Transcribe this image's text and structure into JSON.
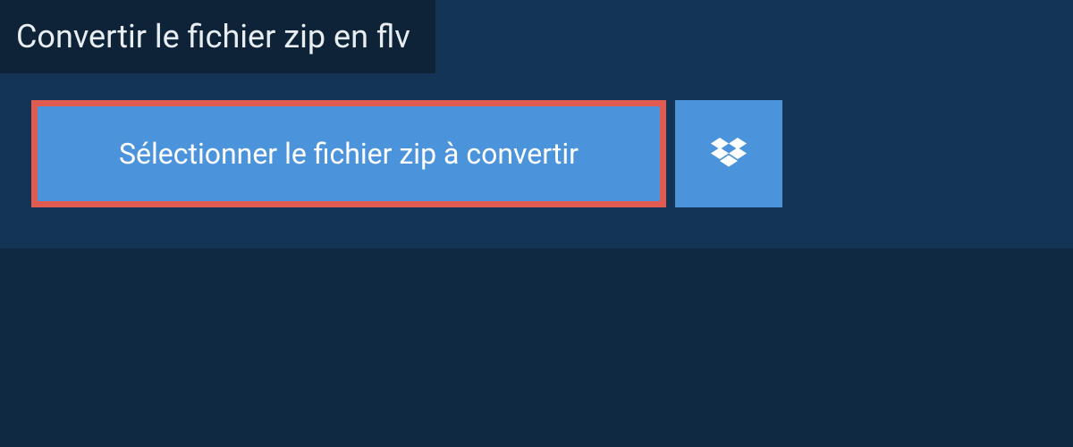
{
  "header": {
    "title": "Convertir le fichier zip en flv"
  },
  "buttons": {
    "select_file": "Sélectionner le fichier zip à convertir"
  },
  "colors": {
    "bg_dark": "#0f2942",
    "bg_panel": "#133454",
    "bg_tab": "#0e2338",
    "btn_blue": "#4b94db",
    "border_red": "#e15b50"
  }
}
